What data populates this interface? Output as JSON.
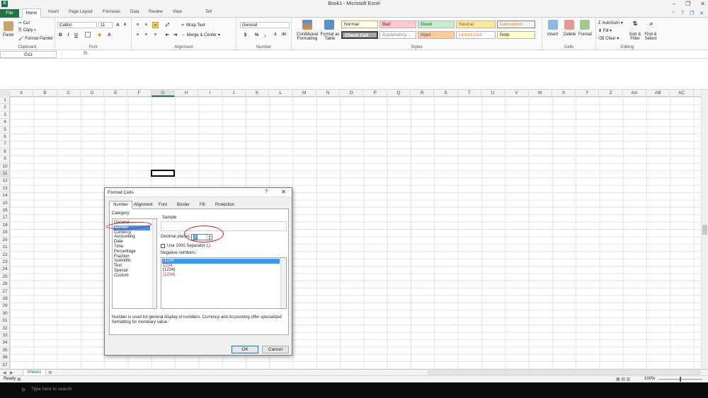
{
  "window": {
    "title": "Book1 - Microsoft Excel",
    "app_icon": "excel-icon"
  },
  "tabs": {
    "file": "File",
    "items": [
      "Home",
      "Insert",
      "Page Layout",
      "Formulas",
      "Data",
      "Review",
      "View",
      "",
      "Tell"
    ]
  },
  "ribbon": {
    "clipboard": {
      "paste": "Paste",
      "cut": "Cut",
      "copy": "Copy",
      "format_painter": "Format Painter",
      "label": "Clipboard"
    },
    "font": {
      "name": "Calibri",
      "size": "11",
      "label": "Font"
    },
    "alignment": {
      "wrap_text": "Wrap Text",
      "merge_center": "Merge & Center",
      "label": "Alignment"
    },
    "number": {
      "format": "General",
      "currency": "$",
      "percent": "%",
      "comma": ",",
      "label": "Number"
    },
    "styles": {
      "conditional": "Conditional Formatting",
      "format_table": "Format as Table",
      "items": [
        "Normal",
        "Bad",
        "Good",
        "Neutral",
        "Calculation",
        "Check Cell",
        "Explanatory ...",
        "Input",
        "Linked Cell",
        "Note"
      ],
      "label": "Styles"
    },
    "cells": {
      "insert": "Insert",
      "delete": "Delete",
      "format": "Format",
      "label": "Cells"
    },
    "editing": {
      "autosum": "AutoSum",
      "fill": "Fill",
      "clear": "Clear",
      "sort_filter": "Sort & Filter",
      "find_select": "Find & Select",
      "label": "Editing"
    }
  },
  "formula_bar": {
    "name_box": "G11",
    "fx": "fx",
    "value": ""
  },
  "grid": {
    "columns": [
      "A",
      "B",
      "C",
      "D",
      "E",
      "F",
      "G",
      "H",
      "I",
      "J",
      "K",
      "L",
      "M",
      "N",
      "O",
      "P",
      "Q",
      "R",
      "S",
      "T",
      "U",
      "V",
      "W",
      "X",
      "Y",
      "Z",
      "AA",
      "AB",
      "AC"
    ],
    "rows": [
      "1",
      "2",
      "3",
      "4",
      "5",
      "6",
      "7",
      "8",
      "9",
      "10",
      "11",
      "12",
      "13",
      "14",
      "15",
      "16",
      "17",
      "18",
      "19",
      "20",
      "21",
      "22",
      "23",
      "24",
      "25",
      "26",
      "27",
      "28",
      "29",
      "30",
      "31",
      "32",
      "33",
      "34",
      "35",
      "36",
      "37"
    ],
    "selected_cell": "G11"
  },
  "sheet": {
    "tab": "Sheet1"
  },
  "status": {
    "ready": "Ready",
    "zoom": "100%"
  },
  "taskbar": {
    "search_placeholder": "Type here to search"
  },
  "dialog": {
    "title": "Format Cells",
    "help": "?",
    "close": "✕",
    "tabs": [
      "Number",
      "Alignment",
      "Font",
      "Border",
      "Fill",
      "Protection"
    ],
    "category_label": "Category:",
    "categories": [
      "General",
      "Number",
      "Currency",
      "Accounting",
      "Date",
      "Time",
      "Percentage",
      "Fraction",
      "Scientific",
      "Text",
      "Special",
      "Custom"
    ],
    "selected_category": "Number",
    "sample_label": "Sample",
    "decimal_label": "Decimal places:",
    "decimal_value": "2",
    "separator_label": "Use 1000 Separator (,)",
    "negative_label": "Negative numbers:",
    "negative_numbers": [
      "-1234",
      "1234",
      "(1234)",
      "(1234)"
    ],
    "description": "Number is used for general display of numbers.  Currency and Accounting offer specialized formatting for monetary value.",
    "ok": "OK",
    "cancel": "Cancel"
  },
  "colors": {
    "excel_green": "#217346",
    "selection_blue": "#3399ff",
    "annotation_red": "#e2141b",
    "negative_red": "#e2141b"
  }
}
